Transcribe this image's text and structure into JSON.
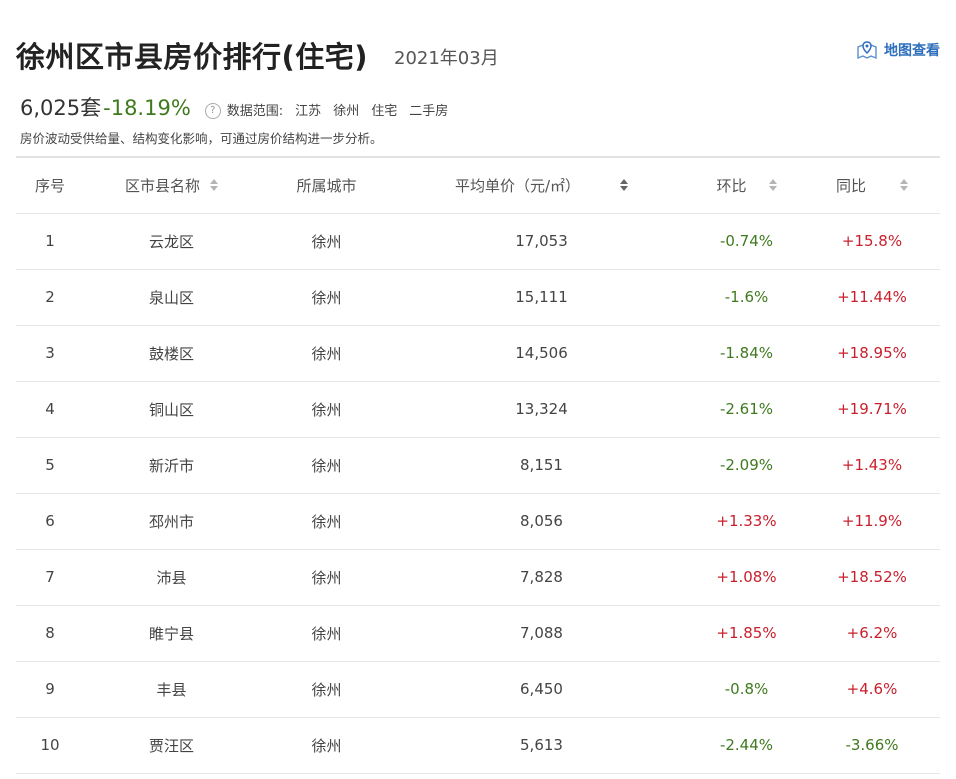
{
  "header": {
    "title": "徐州区市县房价排行(住宅)",
    "date": "2021年03月",
    "map_link": "地图查看",
    "map_icon": "map-pin-icon",
    "accent_color": "#2f6fbd"
  },
  "summary": {
    "count": "6,025套",
    "change": "-18.19%",
    "scope_label": "数据范围:",
    "scope_items": [
      "江苏",
      "徐州",
      "住宅",
      "二手房"
    ],
    "note": "房价波动受供给量、结构变化影响，可通过房价结构进一步分析。"
  },
  "table": {
    "headers": [
      "序号",
      "区市县名称",
      "所属城市",
      "平均单价（元/㎡）",
      "环比",
      "同比"
    ],
    "rows": [
      {
        "rank": "1",
        "name": "云龙区",
        "city": "徐州",
        "price": "17,053",
        "mom": "-0.74%",
        "yoy": "+15.8%"
      },
      {
        "rank": "2",
        "name": "泉山区",
        "city": "徐州",
        "price": "15,111",
        "mom": "-1.6%",
        "yoy": "+11.44%"
      },
      {
        "rank": "3",
        "name": "鼓楼区",
        "city": "徐州",
        "price": "14,506",
        "mom": "-1.84%",
        "yoy": "+18.95%"
      },
      {
        "rank": "4",
        "name": "铜山区",
        "city": "徐州",
        "price": "13,324",
        "mom": "-2.61%",
        "yoy": "+19.71%"
      },
      {
        "rank": "5",
        "name": "新沂市",
        "city": "徐州",
        "price": "8,151",
        "mom": "-2.09%",
        "yoy": "+1.43%"
      },
      {
        "rank": "6",
        "name": "邳州市",
        "city": "徐州",
        "price": "8,056",
        "mom": "+1.33%",
        "yoy": "+11.9%"
      },
      {
        "rank": "7",
        "name": "沛县",
        "city": "徐州",
        "price": "7,828",
        "mom": "+1.08%",
        "yoy": "+18.52%"
      },
      {
        "rank": "8",
        "name": "睢宁县",
        "city": "徐州",
        "price": "7,088",
        "mom": "+1.85%",
        "yoy": "+6.2%"
      },
      {
        "rank": "9",
        "name": "丰县",
        "city": "徐州",
        "price": "6,450",
        "mom": "-0.8%",
        "yoy": "+4.6%"
      },
      {
        "rank": "10",
        "name": "贾汪区",
        "city": "徐州",
        "price": "5,613",
        "mom": "-2.44%",
        "yoy": "-3.66%"
      }
    ]
  },
  "colors": {
    "positive": "#c8202d",
    "negative": "#3f7a1e"
  }
}
